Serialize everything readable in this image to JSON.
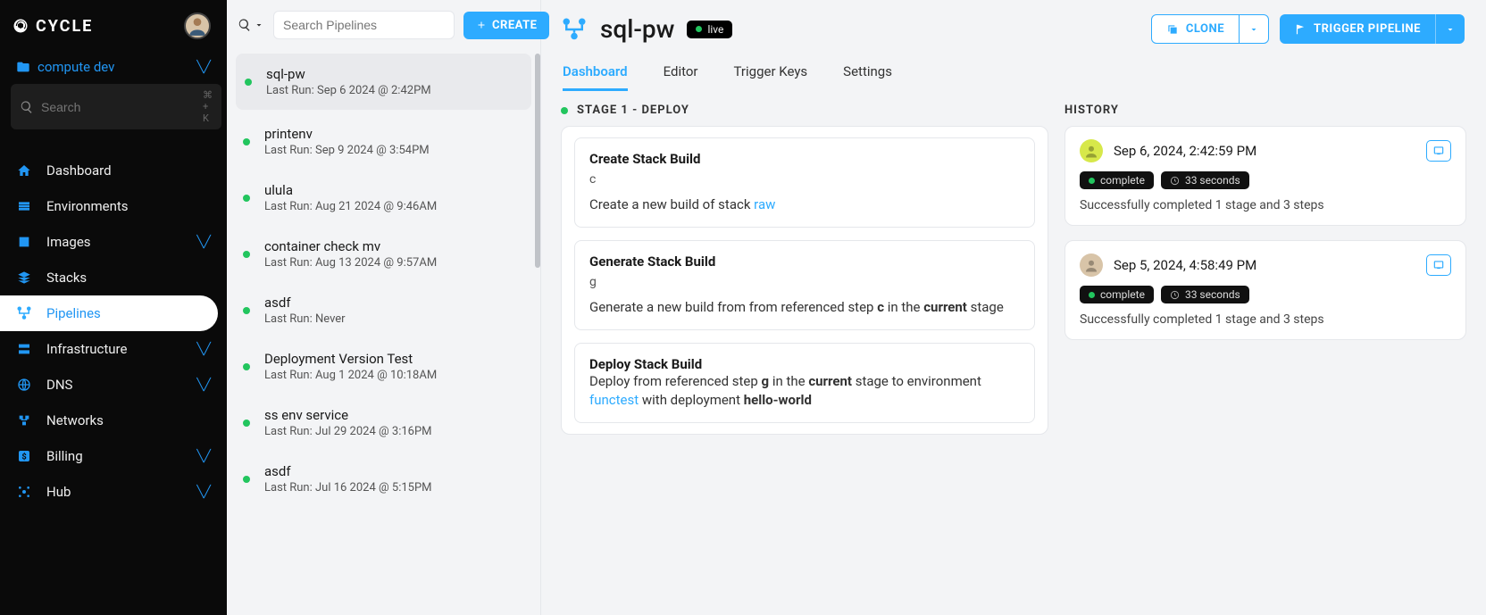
{
  "brand": {
    "name": "CYCLE"
  },
  "hub": {
    "label": "compute dev"
  },
  "sidebarSearch": {
    "placeholder": "Search",
    "shortcut": "⌘ + K"
  },
  "nav": {
    "dashboard": "Dashboard",
    "environments": "Environments",
    "images": "Images",
    "stacks": "Stacks",
    "pipelines": "Pipelines",
    "infrastructure": "Infrastructure",
    "dns": "DNS",
    "networks": "Networks",
    "billing": "Billing",
    "hub": "Hub"
  },
  "pipelines": {
    "searchPlaceholder": "Search Pipelines",
    "createLabel": "CREATE",
    "items": [
      {
        "name": "sql-pw",
        "sub": "Last Run: Sep 6 2024 @ 2:42PM",
        "selected": true
      },
      {
        "name": "printenv",
        "sub": "Last Run: Sep 9 2024 @ 3:54PM"
      },
      {
        "name": "ulula",
        "sub": "Last Run: Aug 21 2024 @ 9:46AM"
      },
      {
        "name": "container check mv",
        "sub": "Last Run: Aug 13 2024 @ 9:57AM"
      },
      {
        "name": "asdf",
        "sub": "Last Run: Never"
      },
      {
        "name": "Deployment Version Test",
        "sub": "Last Run: Aug 1 2024 @ 10:18AM"
      },
      {
        "name": "ss env service",
        "sub": "Last Run: Jul 29 2024 @ 3:16PM"
      },
      {
        "name": "asdf",
        "sub": "Last Run: Jul 16 2024 @ 5:15PM"
      }
    ]
  },
  "detail": {
    "title": "sql-pw",
    "liveBadge": "live",
    "cloneLabel": "CLONE",
    "triggerLabel": "TRIGGER PIPELINE",
    "tabs": {
      "dashboard": "Dashboard",
      "editor": "Editor",
      "triggerKeys": "Trigger Keys",
      "settings": "Settings"
    },
    "stage": {
      "heading": "STAGE 1 - DEPLOY",
      "steps": [
        {
          "title": "Create Stack Build",
          "code": "c",
          "descParts": [
            "Create a new build of stack ",
            {
              "link": "raw"
            }
          ]
        },
        {
          "title": "Generate Stack Build",
          "code": "g",
          "descParts": [
            "Generate a new build from from referenced step ",
            {
              "strong": "c"
            },
            " in the ",
            {
              "strong": "current"
            },
            " stage"
          ]
        },
        {
          "title": "Deploy Stack Build",
          "code": "",
          "descParts": [
            "Deploy from referenced step ",
            {
              "strong": "g"
            },
            " in the ",
            {
              "strong": "current"
            },
            " stage to environment ",
            {
              "link": "functest"
            },
            " with deployment ",
            {
              "strong": "hello-world"
            }
          ]
        }
      ]
    },
    "history": {
      "heading": "HISTORY",
      "runs": [
        {
          "avatarBg": "#d7e84a",
          "time": "Sep 6, 2024, 2:42:59 PM",
          "status": "complete",
          "duration": "33 seconds",
          "summary": "Successfully completed 1 stage and 3 steps"
        },
        {
          "avatarBg": "#d8c4a8",
          "time": "Sep 5, 2024, 4:58:49 PM",
          "status": "complete",
          "duration": "33 seconds",
          "summary": "Successfully completed 1 stage and 3 steps"
        }
      ]
    }
  }
}
